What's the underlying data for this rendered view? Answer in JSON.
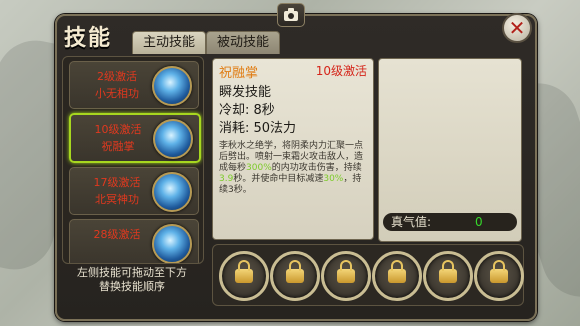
{
  "window": {
    "title": "技能",
    "close_symbol": "✕",
    "camera_icon": "camera-icon"
  },
  "tabs": [
    {
      "label": "主动技能",
      "active": true
    },
    {
      "label": "被动技能",
      "active": false
    }
  ],
  "skill_list": {
    "items": [
      {
        "level_text": "2级激活",
        "name": "小无相功",
        "selected": false
      },
      {
        "level_text": "10级激活",
        "name": "祝融掌",
        "selected": true
      },
      {
        "level_text": "17级激活",
        "name": "北冥神功",
        "selected": false
      },
      {
        "level_text": "28级激活",
        "name": "",
        "selected": false
      }
    ],
    "hint_line1": "左侧技能可拖动至下方",
    "hint_line2": "替换技能顺序"
  },
  "detail": {
    "name": "祝融掌",
    "activate_level": "10级激活",
    "type": "瞬发技能",
    "cooldown": "冷却: 8秒",
    "cost": "消耗: 50法力",
    "description_parts": [
      {
        "text": "李秋水之绝学，将阴柔内力汇聚一点后劈出。喷射一束霜火攻击敌人，造成每秒",
        "highlight": false
      },
      {
        "text": "300%",
        "highlight": true
      },
      {
        "text": "的内功攻击伤害，持续",
        "highlight": false
      },
      {
        "text": "3.9",
        "highlight": true
      },
      {
        "text": "秒。并使命中目标减速",
        "highlight": false
      },
      {
        "text": "30%",
        "highlight": true
      },
      {
        "text": "，持续3秒。",
        "highlight": false
      }
    ]
  },
  "energy": {
    "label": "真气值:",
    "value": "0"
  },
  "slots": {
    "count": 6,
    "icon": "lock-icon"
  },
  "colors": {
    "level_red": "#d5251a",
    "skill_name_orange": "#e07c12",
    "highlight_green": "#7dcb2b",
    "energy_green": "#36d92b",
    "selected_border": "#a7d71f"
  }
}
